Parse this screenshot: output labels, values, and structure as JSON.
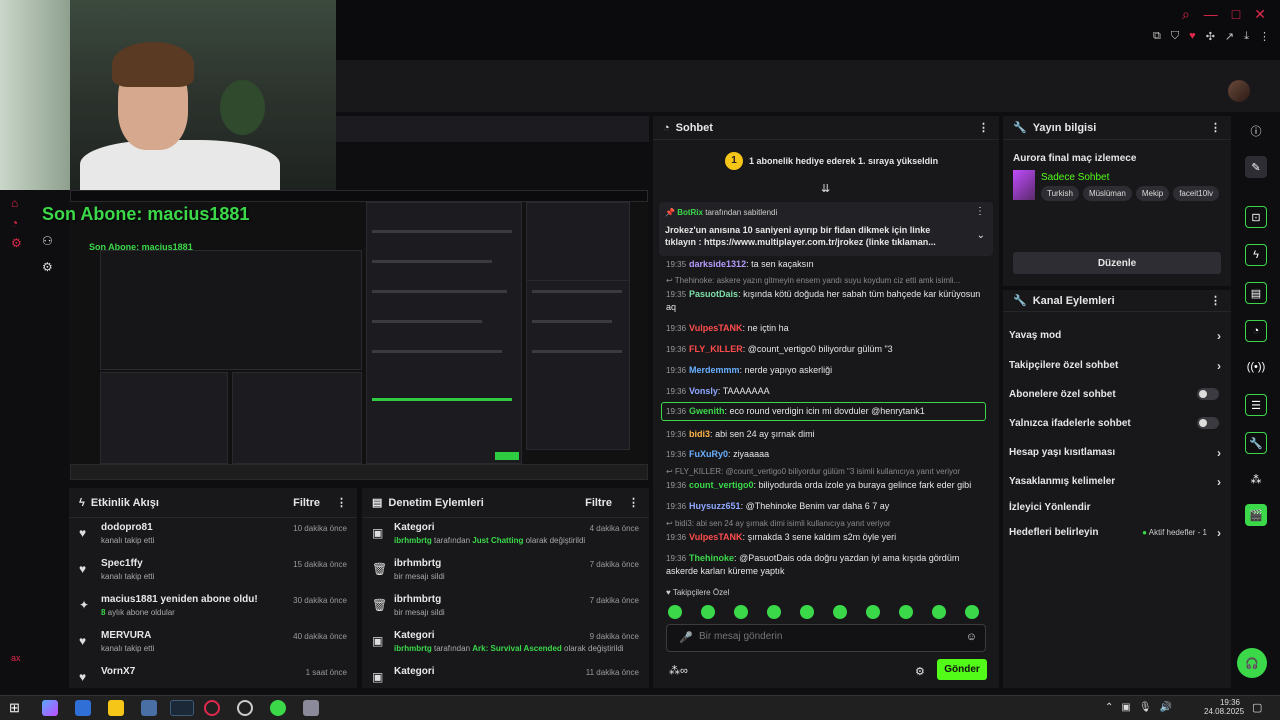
{
  "overlay": {
    "son_abone": "Son Abone: macius1881",
    "son_abone_small": "Son Abone: macius1881",
    "watermark": "ax"
  },
  "activity": {
    "title": "Etkinlik Akışı",
    "filter": "Filtre",
    "items": [
      {
        "name": "dodopro81",
        "sub": "kanalı takip etti",
        "time": "10 dakika önce",
        "icon": "heart-icon"
      },
      {
        "name": "Spec1ffy",
        "sub": "kanalı takip etti",
        "time": "15 dakika önce",
        "icon": "heart-icon"
      },
      {
        "name": "macius1881 yeniden abone oldu!",
        "sub_prefix": "8",
        "sub": " aylık abone oldular",
        "time": "30 dakika önce",
        "icon": "star-icon"
      },
      {
        "name": "MERVURA",
        "sub": "kanalı takip etti",
        "time": "40 dakika önce",
        "icon": "heart-icon"
      },
      {
        "name": "VornX7",
        "sub": "",
        "time": "1 saat önce",
        "icon": "heart-icon"
      }
    ]
  },
  "moderation": {
    "title": "Denetim Eylemleri",
    "filter": "Filtre",
    "items": [
      {
        "name": "Kategori",
        "user": "ibrhmbrtg",
        "mid": " tarafından ",
        "value": "Just Chatting",
        "tail": " olarak değiştirildi",
        "time": "4 dakika önce",
        "icon": "category-icon"
      },
      {
        "name": "ibrhmbrtg",
        "sub": "bir mesajı sildi",
        "time": "7 dakika önce",
        "icon": "trash-icon"
      },
      {
        "name": "ibrhmbrtg",
        "sub": "bir mesajı sildi",
        "time": "7 dakika önce",
        "icon": "trash-icon"
      },
      {
        "name": "Kategori",
        "user": "ibrhmbrtg",
        "mid": " tarafından ",
        "value": "Ark: Survival Ascended",
        "tail": " olarak değiştirildi",
        "time": "9 dakika önce",
        "icon": "category-icon"
      },
      {
        "name": "Kategori",
        "sub": "",
        "time": "11 dakika önce",
        "icon": "category-icon"
      }
    ]
  },
  "chat": {
    "title": "Sohbet",
    "gift_banner": "1 abonelik hediye ederek 1. sıraya yükseldin",
    "gift_badge": "1",
    "pinned_user": "BotRix",
    "pinned_by": "tarafından sabitlendi",
    "pinned_text": "Jrokez'un anısına 10 saniyeni ayırıp bir fidan dikmek için linke tıklayın : https://www.multiplayer.com.tr/jrokez (linke tıklaman...",
    "messages": [
      {
        "time": "19:35",
        "user": "darkside1312",
        "color": "#b59cff",
        "text": "ta sen kaçaksın"
      },
      {
        "reply": "Thehinoke: askere yazın gitmeyin ensem yandı suyu koydum ciz etti amk isimli..."
      },
      {
        "time": "19:35",
        "user": "PasuotDais",
        "color": "#7ee0a8",
        "text": "kışında kötü doğuda her sabah tüm bahçede kar kürüyosun aq"
      },
      {
        "time": "19:36",
        "user": "VulpesTANK",
        "color": "#ff4d4d",
        "text": "ne içtin ha"
      },
      {
        "time": "19:36",
        "user": "FLY_KILLER",
        "color": "#ff4d4d",
        "text": "@count_vertigo0 biliyordur gülüm \"3"
      },
      {
        "time": "19:36",
        "user": "Merdemmm",
        "color": "#6ab0ff",
        "text": "nerde yapıyo askerliği"
      },
      {
        "time": "19:36",
        "user": "Vonsly",
        "color": "#8fa8ff",
        "text": "TAAAAAAA"
      },
      {
        "time": "19:36",
        "user": "Gwenith",
        "color": "#3bd84a",
        "text": "eco round verdigin icin mi dovduler @henrytank1"
      },
      {
        "time": "19:36",
        "user": "bidi3",
        "color": "#ffb347",
        "text": "abi sen 24 ay şırnak dimi"
      },
      {
        "time": "19:36",
        "user": "FuXuRy0",
        "color": "#6ab0ff",
        "text": "ziyaaaaa"
      },
      {
        "reply": "FLY_KILLER: @count_vertigo0 biliyordur gülüm \"3 isimli kullanıcıya yanıt veriyor"
      },
      {
        "time": "19:36",
        "user": "count_vertigo0",
        "color": "#3bd84a",
        "text": "biliyodurda orda izole ya buraya gelince fark eder gibi"
      },
      {
        "time": "19:36",
        "user": "Huysuzz651",
        "color": "#8fa8ff",
        "text": "@Thehinoke Benim var daha 6 7 ay"
      },
      {
        "reply": "bidi3: abi sen 24 ay şırnak dimi isimli kullanıcıya yanıt veriyor"
      },
      {
        "time": "19:36",
        "user": "VulpesTANK",
        "color": "#ff4d4d",
        "text": "şırnakda 3 sene kaldım s2m öyle yeri"
      },
      {
        "time": "19:36",
        "user": "Thehinoke",
        "color": "#3bd84a",
        "text": "@PasuotDais oda doğru yazdan iyi ama kışıda gördüm askerde karları küreme yaptık"
      }
    ],
    "followers_only": "Takipçilere Özel",
    "input_placeholder": "Bir mesaj gönderin",
    "send_label": "Gönder"
  },
  "stream_info": {
    "title": "Yayın bilgisi",
    "stream_title": "Aurora final maç izlemece",
    "category": "Sadece Sohbet",
    "tags": [
      "Turkish",
      "Müslüman",
      "Mekip",
      "faceit10lv"
    ],
    "edit_label": "Düzenle"
  },
  "channel_actions": {
    "title": "Kanal Eylemleri",
    "items": [
      {
        "label": "Yavaş mod",
        "control": "chevron"
      },
      {
        "label": "Takipçilere özel sohbet",
        "control": "chevron"
      },
      {
        "label": "Abonelere özel sohbet",
        "control": "toggle"
      },
      {
        "label": "Yalnızca ifadelerle sohbet",
        "control": "toggle"
      },
      {
        "label": "Hesap yaşı kısıtlaması",
        "control": "chevron"
      },
      {
        "label": "Yasaklanmış kelimeler",
        "control": "chevron"
      },
      {
        "label": "İzleyici Yönlendir",
        "control": "none"
      },
      {
        "label": "Hedefleri belirleyin",
        "control": "chevron",
        "extra": "Aktif hedefler - 1"
      }
    ]
  },
  "taskbar": {
    "time": "19:36",
    "date": "24.08.2025"
  },
  "colors": {
    "accent": "#53fc18",
    "brand_red": "#e0294d",
    "panel": "#18181b",
    "bg": "#0e0e10"
  }
}
